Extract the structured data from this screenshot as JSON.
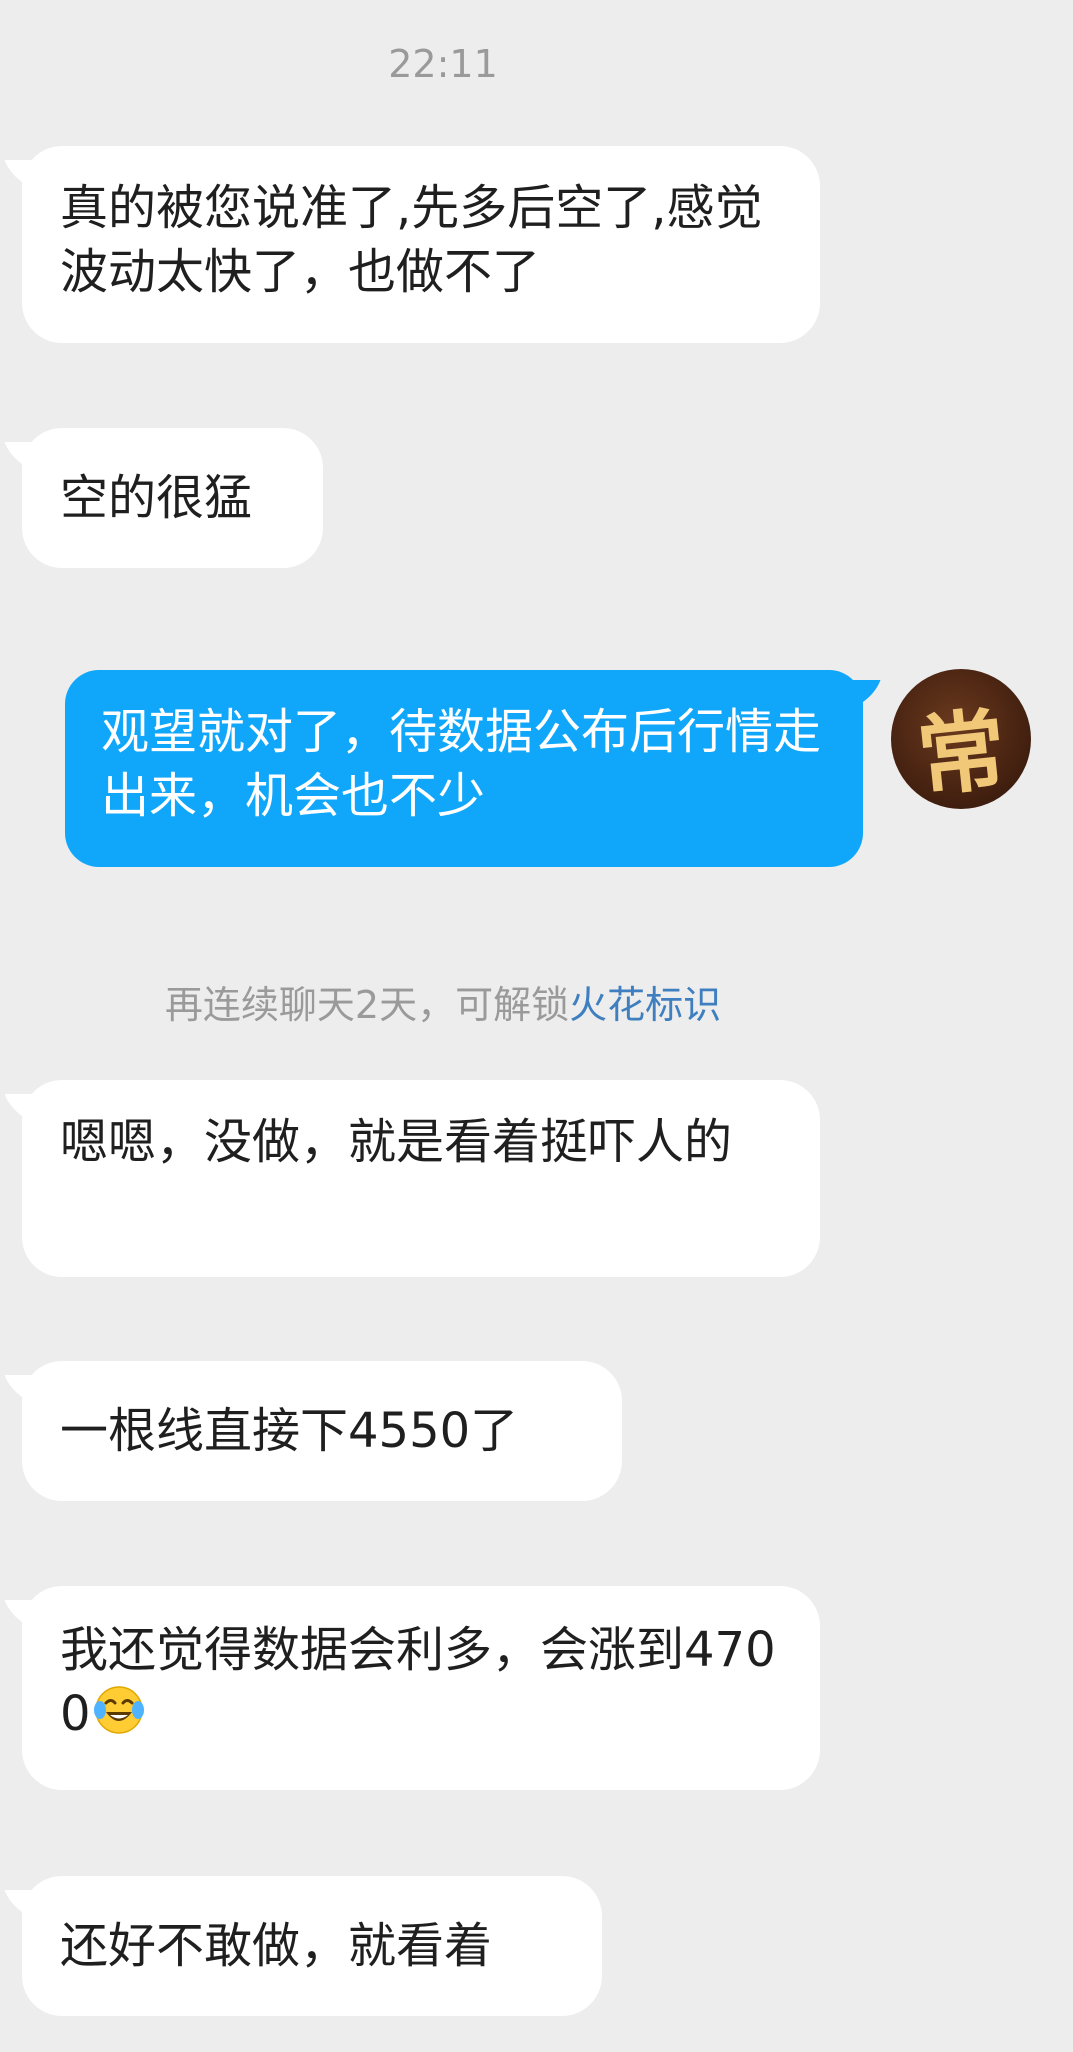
{
  "header": {
    "time": "22:11"
  },
  "messages": {
    "m1": "真的被您说准了,先多后空了,感觉波动太快了，也做不了",
    "m2": "空的很猛",
    "m3": "观望就对了，待数据公布后行情走出来，机会也不少",
    "m4": "嗯嗯，没做，就是看着挺吓人的",
    "m5": "一根线直接下4550了",
    "m6": "我还觉得数据会利多，会涨到4700",
    "m7": "还好不敢做，就看着"
  },
  "system_note": {
    "prefix": "再连续聊天2天，可解锁",
    "link": "火花标识"
  },
  "avatar": {
    "glyph": "常"
  },
  "icons": {
    "m6_emoji": "laughing-crying-emoji"
  },
  "colors": {
    "background": "#ededed",
    "incoming_bubble": "#ffffff",
    "outgoing_bubble": "#10a7fb",
    "link": "#3f7fbf"
  }
}
